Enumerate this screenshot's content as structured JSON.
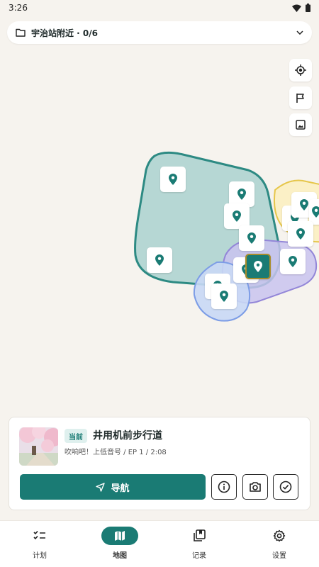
{
  "status_bar": {
    "time": "3:26"
  },
  "folder": {
    "title": "宇治站附近 · 0/6",
    "icon": "folder-icon"
  },
  "map_controls": {
    "locate_icon": "locate-icon",
    "flag_icon": "flag-icon",
    "image_icon": "image-icon"
  },
  "colors": {
    "primary": "#1a7b74",
    "zone_green": "#b6d7d4",
    "zone_purple": "#c9c3ef",
    "zone_blue": "#c9d8f5",
    "zone_yellow": "#fbf0c6"
  },
  "current_card": {
    "badge": "当前",
    "title": "井用机前步行道",
    "subtitle": "吹响吧！上低音号 / EP 1 / 2:08",
    "navigate_label": "导航"
  },
  "bottom_nav": {
    "items": [
      {
        "label": "计划",
        "icon": "checklist-icon"
      },
      {
        "label": "地图",
        "icon": "map-icon"
      },
      {
        "label": "记录",
        "icon": "collection-icon"
      },
      {
        "label": "设置",
        "icon": "gear-icon"
      }
    ]
  }
}
